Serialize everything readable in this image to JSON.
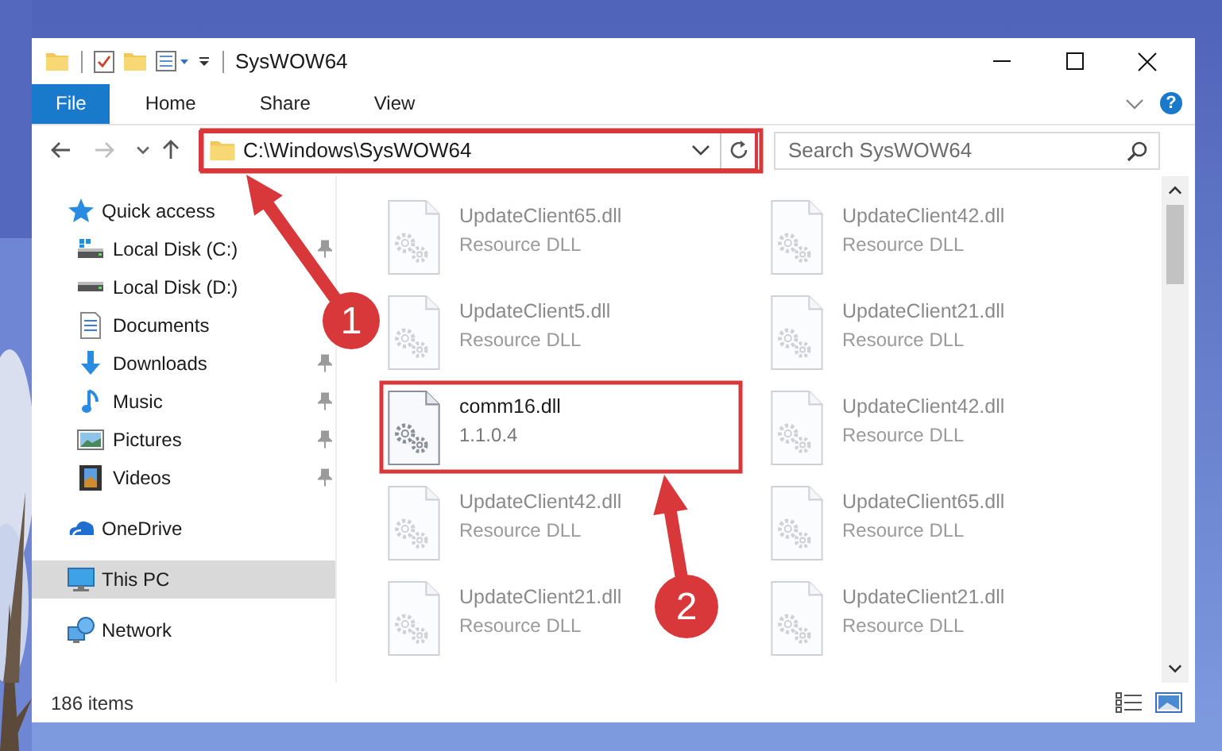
{
  "window": {
    "title": "SysWOW64",
    "caption_buttons": [
      {
        "kind": "minimize"
      },
      {
        "kind": "maximize"
      },
      {
        "kind": "close"
      }
    ]
  },
  "ribbon": {
    "tabs": [
      {
        "label": "File",
        "selected": true
      },
      {
        "label": "Home",
        "selected": false
      },
      {
        "label": "Share",
        "selected": false
      },
      {
        "label": "View",
        "selected": false
      }
    ],
    "help": "?"
  },
  "navigation": {
    "back_disabled": false,
    "forward_disabled": true
  },
  "address": {
    "path": "C:\\Windows\\SysWOW64"
  },
  "search": {
    "placeholder": "Search SysWOW64"
  },
  "sidebar": {
    "items": [
      {
        "label": "Quick access",
        "kind": "quick-access",
        "selected": false,
        "children": [
          {
            "label": "Local Disk (C:)",
            "kind": "system-drive",
            "selected": false,
            "pinned": true
          },
          {
            "label": "Local Disk (D:)",
            "kind": "drive",
            "selected": false,
            "pinned": false
          },
          {
            "label": "Documents",
            "kind": "documents",
            "selected": false,
            "pinned": false
          },
          {
            "label": "Downloads",
            "kind": "downloads",
            "selected": false,
            "pinned": true
          },
          {
            "label": "Music",
            "kind": "music",
            "selected": false,
            "pinned": true
          },
          {
            "label": "Pictures",
            "kind": "pictures",
            "selected": false,
            "pinned": true
          },
          {
            "label": "Videos",
            "kind": "videos",
            "selected": false,
            "pinned": true
          }
        ]
      },
      {
        "label": "OneDrive",
        "kind": "cloud",
        "selected": false
      },
      {
        "label": "This PC",
        "kind": "computer",
        "selected": true
      },
      {
        "label": "Network",
        "kind": "network",
        "selected": false
      }
    ]
  },
  "files": [
    {
      "name": "UpdateClient65.dll",
      "detail": "Resource DLL",
      "faded": true
    },
    {
      "name": "UpdateClient42.dll",
      "detail": "Resource DLL",
      "faded": true
    },
    {
      "name": "UpdateClient5.dll",
      "detail": "Resource DLL",
      "faded": true
    },
    {
      "name": "UpdateClient21.dll",
      "detail": "Resource DLL",
      "faded": true
    },
    {
      "name": "comm16.dll",
      "detail": "1.1.0.4",
      "faded": false
    },
    {
      "name": "UpdateClient42.dll",
      "detail": "Resource DLL",
      "faded": true
    },
    {
      "name": "UpdateClient42.dll",
      "detail": "Resource DLL",
      "faded": true
    },
    {
      "name": "UpdateClient65.dll",
      "detail": "Resource DLL",
      "faded": true
    },
    {
      "name": "UpdateClient21.dll",
      "detail": "Resource DLL",
      "faded": true
    },
    {
      "name": "UpdateClient21.dll",
      "detail": "Resource DLL",
      "faded": true
    }
  ],
  "status_bar": {
    "item_count": "186 items"
  },
  "annotations": [
    {
      "number": "1"
    },
    {
      "number": "2"
    }
  ]
}
